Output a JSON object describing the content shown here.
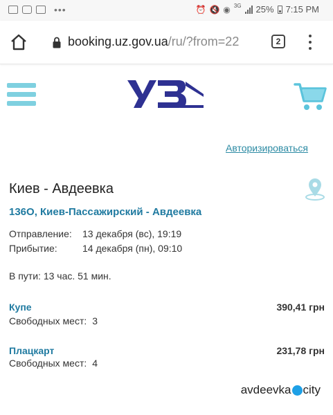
{
  "statusbar": {
    "network_label": "3G",
    "battery_percent": "25%",
    "time": "7:15 PM",
    "icons": [
      "sim-card-icon",
      "message-icon",
      "image-icon",
      "more-dots-icon",
      "alarm-icon",
      "mute-icon",
      "nfc-icon",
      "signal-icon",
      "battery-icon"
    ]
  },
  "browser": {
    "url_domain": "booking.uz.gov.ua",
    "url_path": "/ru/?from=22",
    "tab_count": "2",
    "icons": [
      "home-icon",
      "lock-icon",
      "tabs-icon",
      "kebab-menu-icon"
    ]
  },
  "site": {
    "logo_text": "УЗ",
    "brand_color": "#2e3192",
    "accent_color": "#7fd0e0",
    "link_color": "#1f7aa0",
    "auth_link": "Авторизироваться"
  },
  "trip": {
    "route": "Киев - Авдеевка",
    "train": "136О, Киев-Пассажирский - Авдеевка",
    "departure_label": "Отправление:",
    "departure_value": "13 декабря (вс), 19:19",
    "arrival_label": "Прибытие:",
    "arrival_value": "14 декабря (пн), 09:10",
    "duration": "В пути: 13 час. 51 мин."
  },
  "seats": [
    {
      "type": "Купе",
      "price": "390,41 грн",
      "free_label": "Свободных мест:",
      "free_count": "3"
    },
    {
      "type": "Плацкарт",
      "price": "231,78 грн",
      "free_label": "Свободных мест:",
      "free_count": "4"
    }
  ],
  "watermark": {
    "left": "avdeevka",
    "right": "city"
  }
}
